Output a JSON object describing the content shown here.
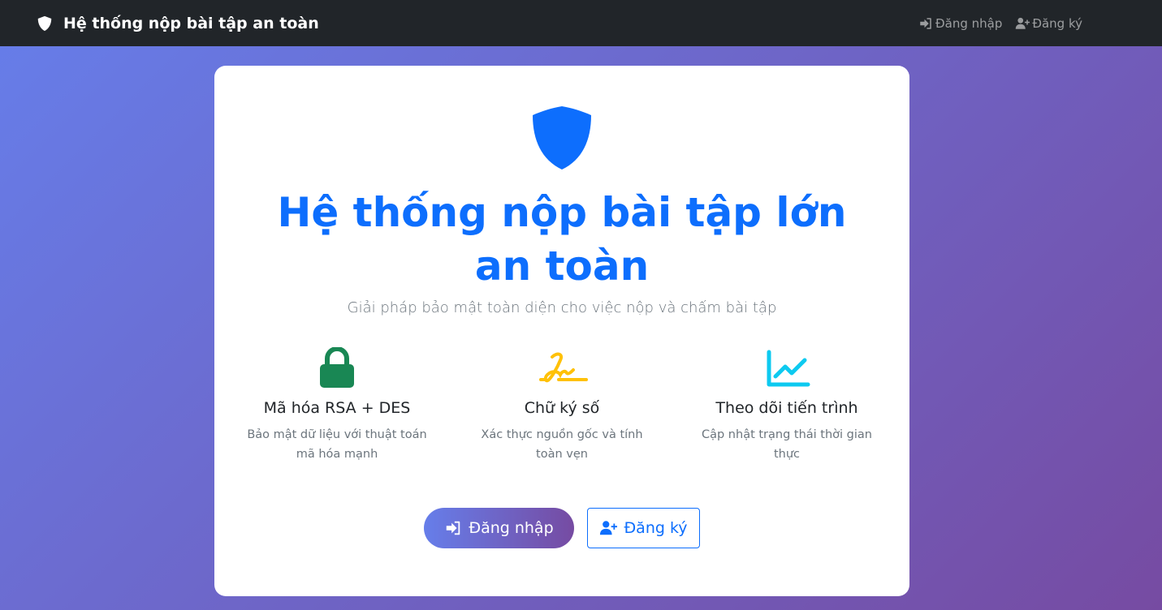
{
  "navbar": {
    "brand": "Hệ thống nộp bài tập an toàn",
    "login": "Đăng nhập",
    "register": "Đăng ký"
  },
  "hero": {
    "title": "Hệ thống nộp bài tập lớn an toàn",
    "subtitle": "Giải pháp bảo mật toàn diện cho việc nộp và chấm bài tập"
  },
  "features": [
    {
      "icon": "lock-icon",
      "color": "#198754",
      "title": "Mã hóa RSA + DES",
      "desc": "Bảo mật dữ liệu với thuật toán mã hóa mạnh"
    },
    {
      "icon": "signature-icon",
      "color": "#ffc107",
      "title": "Chữ ký số",
      "desc": "Xác thực nguồn gốc và tính toàn vẹn"
    },
    {
      "icon": "chart-line-icon",
      "color": "#0dcaf0",
      "title": "Theo dõi tiến trình",
      "desc": "Cập nhật trạng thái thời gian thực"
    }
  ],
  "buttons": {
    "login": "Đăng nhập",
    "register": "Đăng ký"
  },
  "colors": {
    "primary": "#0d6efd",
    "navbar": "#212529",
    "gradient_start": "#667eea",
    "gradient_end": "#764ba2"
  }
}
